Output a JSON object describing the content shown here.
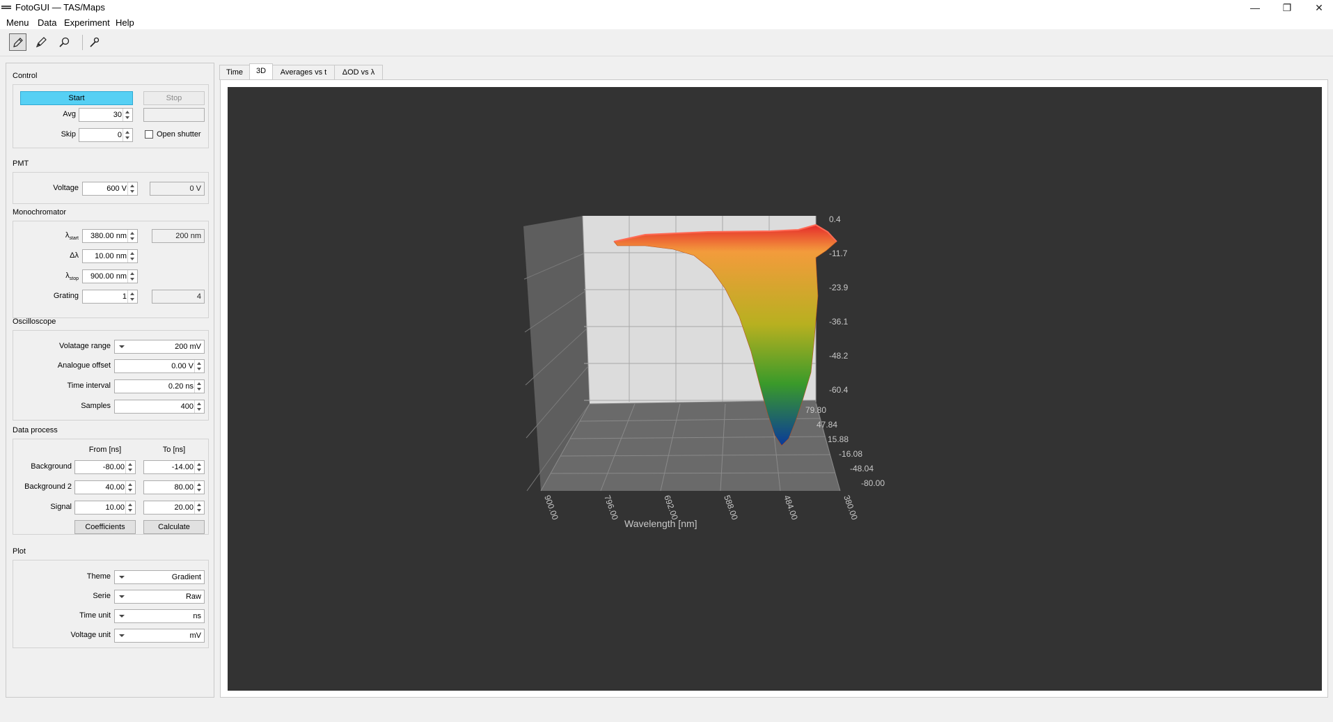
{
  "window": {
    "title": "FotoGUI — TAS/Maps",
    "min_glyph": "—",
    "max_glyph": "❐",
    "close_glyph": "✕"
  },
  "menu": [
    "Menu",
    "Data",
    "Experiment",
    "Help"
  ],
  "toolbar": {
    "icons": [
      "pencil-icon",
      "brush-icon",
      "magnifier-icon",
      "wrench-icon"
    ]
  },
  "control": {
    "title": "Control",
    "start_label": "Start",
    "stop_label": "Stop",
    "avg_label": "Avg",
    "avg_value": "30",
    "avg_readout": "",
    "skip_label": "Skip",
    "skip_value": "0",
    "shutter_label": "Open shutter"
  },
  "pmt": {
    "title": "PMT",
    "voltage_label": "Voltage",
    "voltage_value": "600 V",
    "voltage_readout": "0 V"
  },
  "mono": {
    "title": "Monochromator",
    "lstart_main": "λ",
    "lstart_sub": "start",
    "lstart_value": "380.00 nm",
    "lstart_readout": "200 nm",
    "dl_label": "Δλ",
    "dl_value": "10.00 nm",
    "lstop_main": "λ",
    "lstop_sub": "stop",
    "lstop_value": "900.00 nm",
    "grating_label": "Grating",
    "grating_value": "1",
    "grating_readout": "4"
  },
  "osc": {
    "title": "Oscilloscope",
    "range_label": "Volatage range",
    "range_value": "200 mV",
    "offset_label": "Analogue offset",
    "offset_value": "0.00 V",
    "interval_label": "Time interval",
    "interval_value": "0.20 ns",
    "samples_label": "Samples",
    "samples_value": "400"
  },
  "process": {
    "title": "Data process",
    "from_header": "From [ns]",
    "to_header": "To [ns]",
    "rows": [
      {
        "label": "Background",
        "from": "-80.00",
        "to": "-14.00"
      },
      {
        "label": "Background 2",
        "from": "40.00",
        "to": "80.00"
      },
      {
        "label": "Signal",
        "from": "10.00",
        "to": "20.00"
      }
    ],
    "coeff_label": "Coefficients",
    "calc_label": "Calculate"
  },
  "plot": {
    "title": "Plot",
    "theme_label": "Theme",
    "theme_value": "Gradient",
    "serie_label": "Serie",
    "serie_value": "Raw",
    "timeunit_label": "Time unit",
    "timeunit_value": "ns",
    "voltunit_label": "Voltage unit",
    "voltunit_value": "mV"
  },
  "tabs": [
    "Time",
    "3D",
    "Averages vs t",
    "ΔOD vs λ"
  ],
  "active_tab": 1,
  "chart_data": {
    "type": "surface3d",
    "xlabel": "Wavelength [nm]",
    "x_ticks": [
      "900.00",
      "796.00",
      "692.00",
      "588.00",
      "484.00",
      "380.00"
    ],
    "ylabel": "",
    "y_ticks": [
      "79.80",
      "47.84",
      "15.88",
      "-16.08",
      "-48.04",
      "-80.00"
    ],
    "zlabel": "",
    "z_ticks": [
      "0.4",
      "-11.7",
      "-23.9",
      "-36.1",
      "-48.2",
      "-60.4"
    ],
    "zlim": [
      -60.4,
      0.4
    ],
    "colormap": [
      "#e52b2b",
      "#f39b3c",
      "#b8b020",
      "#3a9a2a",
      "#0a3a9a"
    ],
    "background": "#333333"
  }
}
